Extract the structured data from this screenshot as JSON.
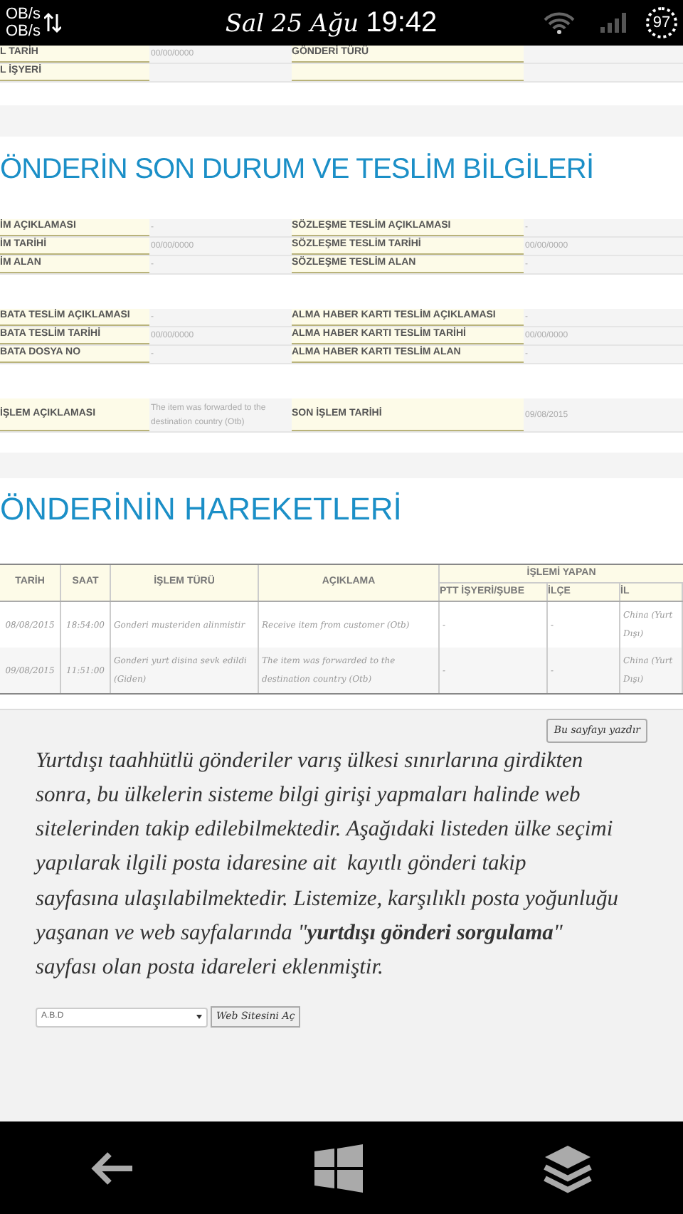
{
  "status_bar": {
    "up_speed": "OB/s",
    "down_speed": "OB/s",
    "date": "Sal 25 Ağu",
    "time": "19:42",
    "battery": "97"
  },
  "top_rows": [
    {
      "label": "L TARİH",
      "value": "00/00/0000",
      "label2": "GÖNDERİ TÜRÜ",
      "value2": ""
    },
    {
      "label": "L İŞYERİ",
      "value": "",
      "label2": "",
      "value2": ""
    }
  ],
  "status_section": {
    "heading": "ÖNDERİN SON DURUM VE TESLİM BİLGİLERİ",
    "groups": [
      [
        {
          "label": "İM AÇIKLAMASI",
          "value": "-",
          "label2": "SÖZLEŞME TESLİM AÇIKLAMASI",
          "value2": "-"
        },
        {
          "label": "İM TARİHİ",
          "value": "00/00/0000",
          "label2": "SÖZLEŞME TESLİM TARİHİ",
          "value2": "00/00/0000"
        },
        {
          "label": "İM ALAN",
          "value": "-",
          "label2": "SÖZLEŞME TESLİM ALAN",
          "value2": "-"
        }
      ],
      [
        {
          "label": "BATA TESLİM AÇIKLAMASI",
          "value": "-",
          "label2": "ALMA HABER KARTI TESLİM AÇIKLAMASI",
          "value2": "-"
        },
        {
          "label": "BATA TESLİM TARİHİ",
          "value": "00/00/0000",
          "label2": "ALMA HABER KARTI TESLİM TARİHİ",
          "value2": "00/00/0000"
        },
        {
          "label": "BATA DOSYA NO",
          "value": "-",
          "label2": "ALMA HABER KARTI TESLİM ALAN",
          "value2": "-"
        }
      ],
      [
        {
          "label": "İŞLEM AÇIKLAMASI",
          "value": "The item was forwarded to the destination country (Otb)",
          "label2": "SON İŞLEM TARİHİ",
          "value2": "09/08/2015"
        }
      ]
    ]
  },
  "movements": {
    "heading": "ÖNDERİNİN HAREKETLERİ",
    "columns": [
      "TARİH",
      "SAAT",
      "İŞLEM TÜRÜ",
      "AÇIKLAMA"
    ],
    "group_header": "İŞLEMİ YAPAN",
    "sub_columns": [
      "PTT İŞYERİ/ŞUBE",
      "İLÇE",
      "İL"
    ],
    "rows": [
      [
        "08/08/2015",
        "18:54:00",
        "Gonderi musteriden alinmistir",
        "Receive item from customer (Otb)",
        "-",
        "-",
        "China (Yurt Dışı)"
      ],
      [
        "09/08/2015",
        "11:51:00",
        "Gonderi yurt disina sevk edildi (Giden)",
        "The item was forwarded to the destination country (Otb)",
        "-",
        "-",
        "China (Yurt Dışı)"
      ]
    ]
  },
  "print_button": "Bu sayfayı yazdır",
  "info_text": "Yurtdışı taahhütlü gönderiler varış ülkesi sınırlarına girdikten sonra, bu ülkelerin sisteme bilgi girişi yapmaları halinde web sitelerinden takip edilebilmektedir. Aşağıdaki listeden ülke seçimi yapılarak ilgili posta idaresine ait  kayıtlı gönderi takip  sayfasına ulaşılabilmektedir. Listemize, karşılıklı posta yoğunluğu yaşanan ve web sayfalarında \"**yurtdışı gönderi sorgulama**\" sayfası olan posta idareleri eklenmiştir.",
  "country_select": {
    "value": "A.B.D"
  },
  "open_button": "Web Sitesini Aç"
}
